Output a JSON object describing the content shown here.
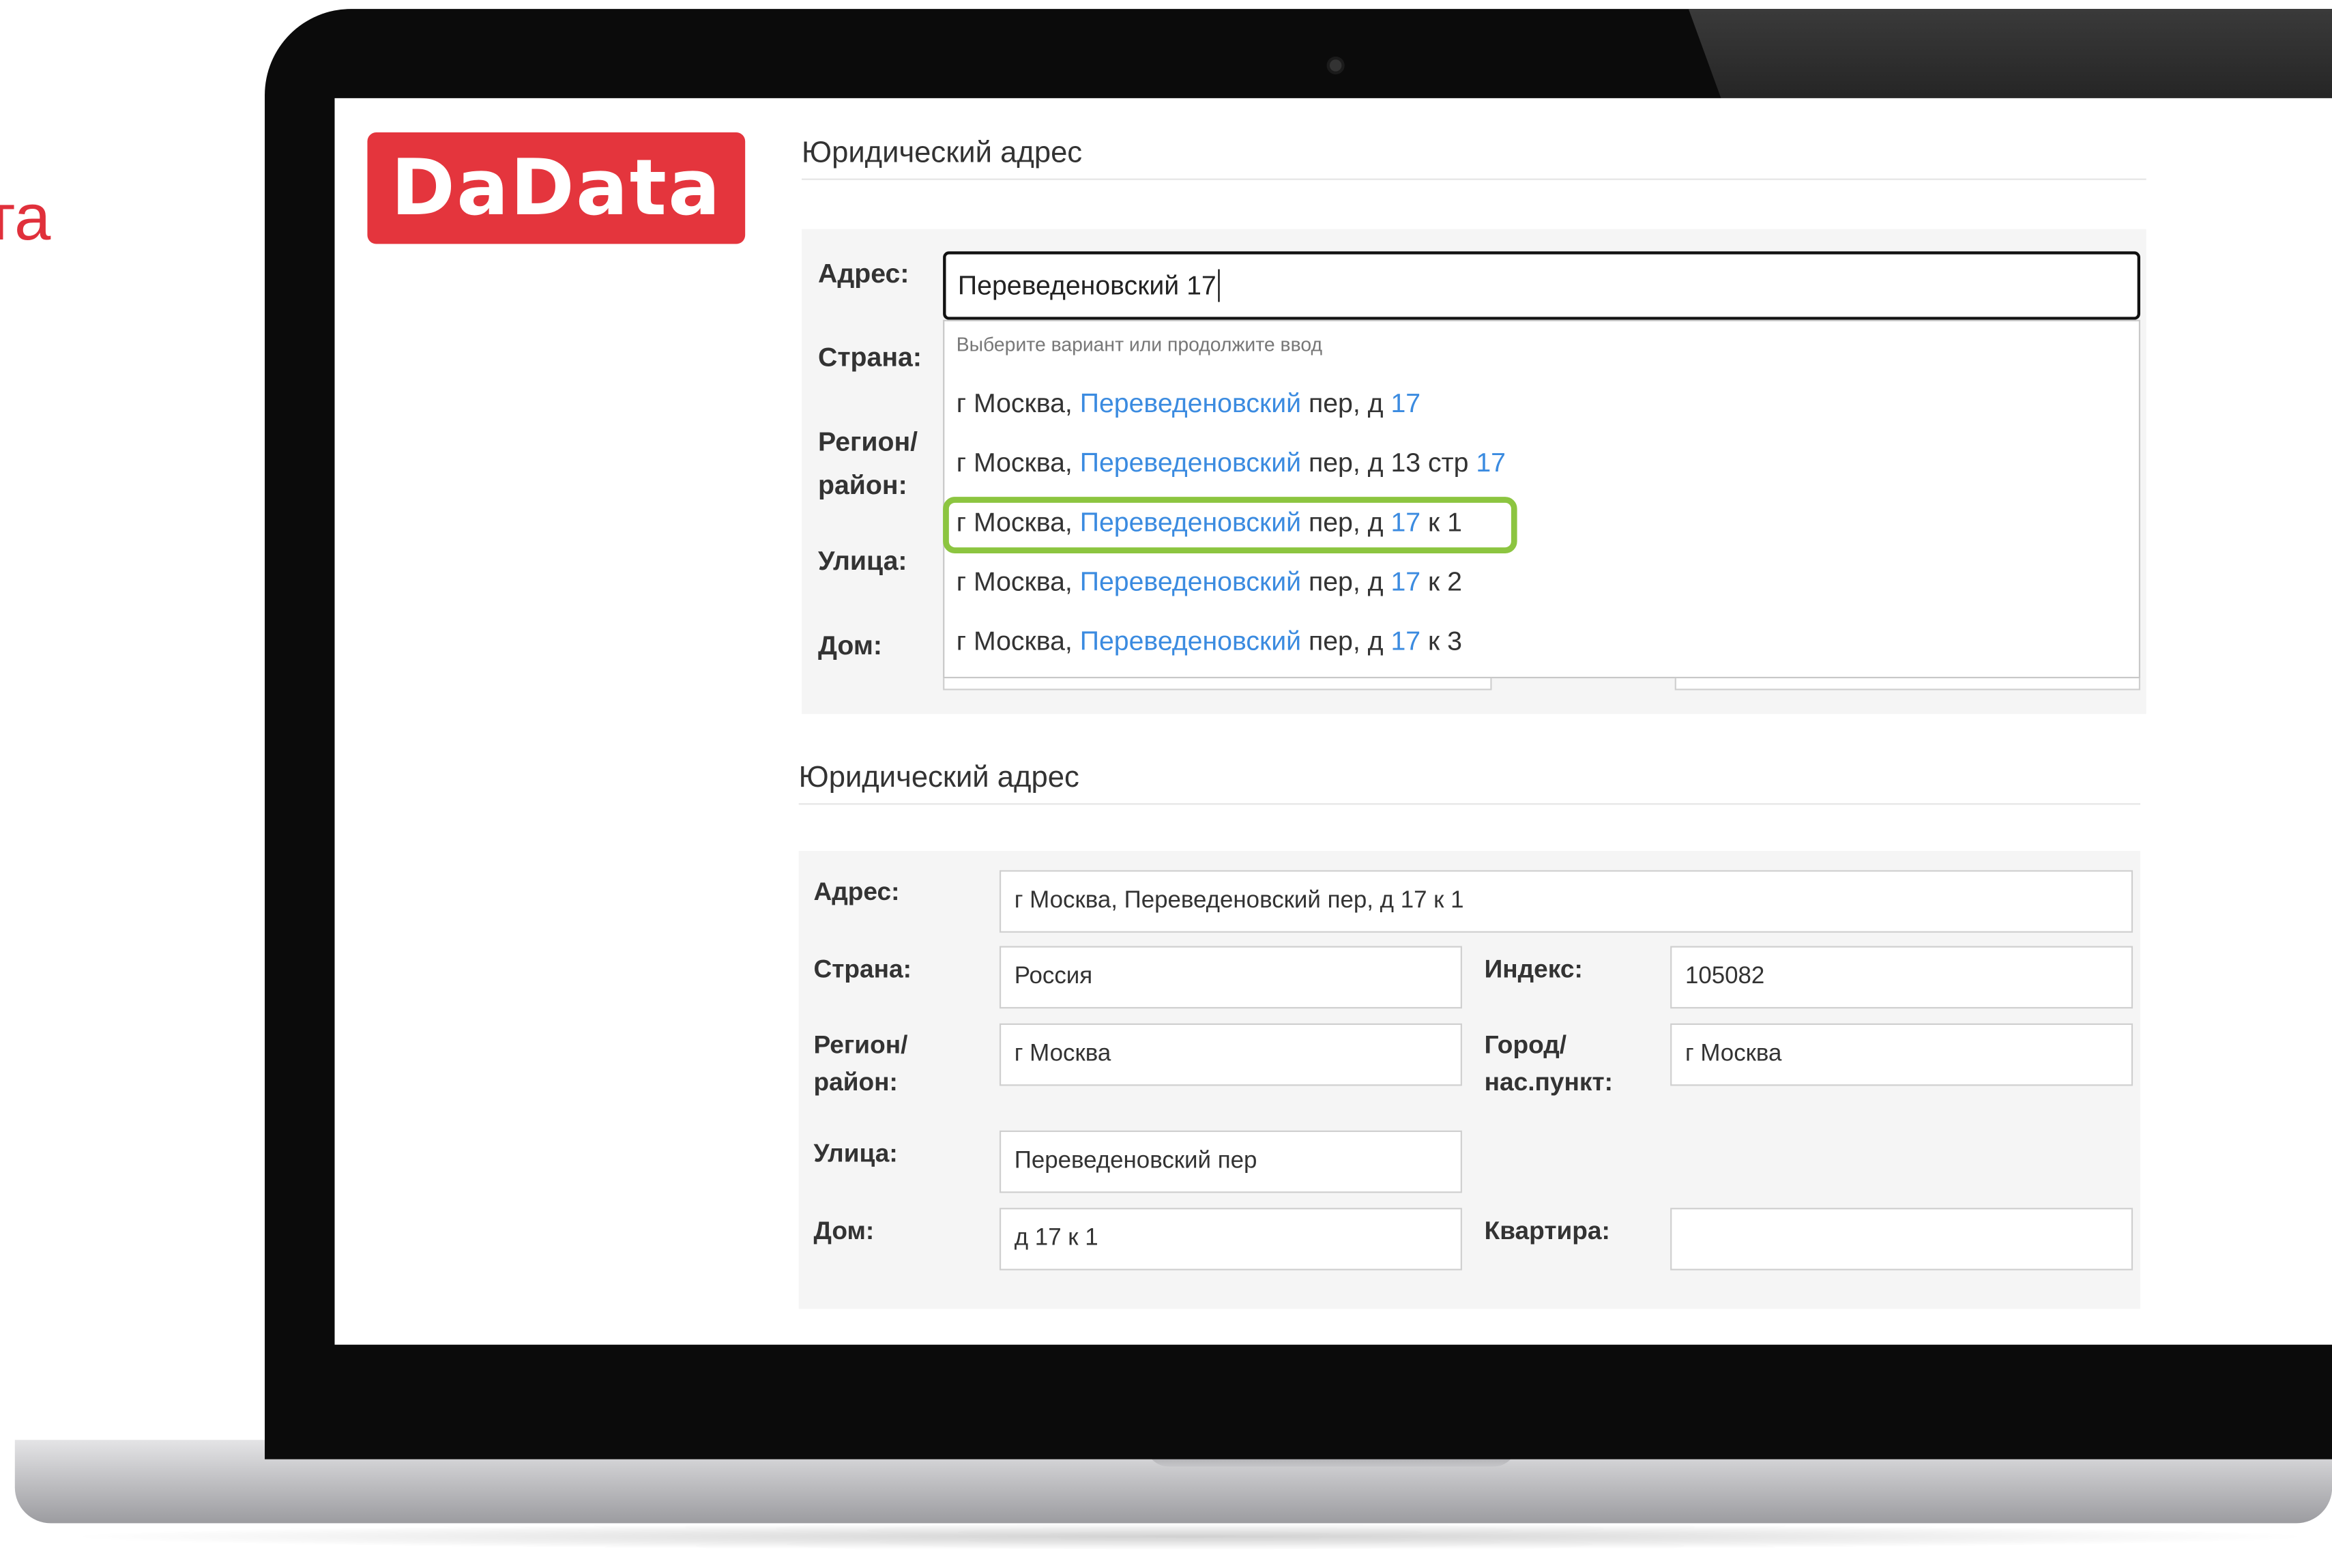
{
  "left_fragment": "та",
  "logo": {
    "text": "DaData",
    "color": "#e4353d"
  },
  "colors": {
    "accent_highlight": "#3b8be0",
    "selection_border": "#8cc540"
  },
  "top_form": {
    "title": "Юридический адрес",
    "labels": {
      "address": "Адрес:",
      "country": "Страна:",
      "region": "Регион/ район:",
      "street": "Улица:",
      "house": "Дом:"
    },
    "input_value": "Переведеновский 17",
    "dropdown_hint": "Выберите вариант или продолжите ввод",
    "suggestions": [
      {
        "prefix": "г Москва, ",
        "hl": "Переведеновский",
        "mid": " пер, д ",
        "num": "17",
        "tail": ""
      },
      {
        "prefix": "г Москва, ",
        "hl": "Переведеновский",
        "mid": " пер, д 13 стр ",
        "num": "17",
        "tail": ""
      },
      {
        "prefix": "г Москва, ",
        "hl": "Переведеновский",
        "mid": " пер, д ",
        "num": "17",
        "tail": " к 1"
      },
      {
        "prefix": "г Москва, ",
        "hl": "Переведеновский",
        "mid": " пер, д ",
        "num": "17",
        "tail": " к 2"
      },
      {
        "prefix": "г Москва, ",
        "hl": "Переведеновский",
        "mid": " пер, д ",
        "num": "17",
        "tail": " к 3"
      }
    ]
  },
  "bottom_form": {
    "title": "Юридический адрес",
    "labels": {
      "address": "Адрес:",
      "country": "Страна:",
      "index": "Индекс:",
      "region": "Регион/ район:",
      "city": "Город/ нас.пункт:",
      "street": "Улица:",
      "house": "Дом:",
      "apartment": "Квартира:"
    },
    "values": {
      "address": "г Москва, Переведеновский пер, д 17 к 1",
      "country": "Россия",
      "index": "105082",
      "region": "г Москва",
      "city": "г Москва",
      "street": "Переведеновский пер",
      "house": "д 17 к 1",
      "apartment": ""
    }
  }
}
